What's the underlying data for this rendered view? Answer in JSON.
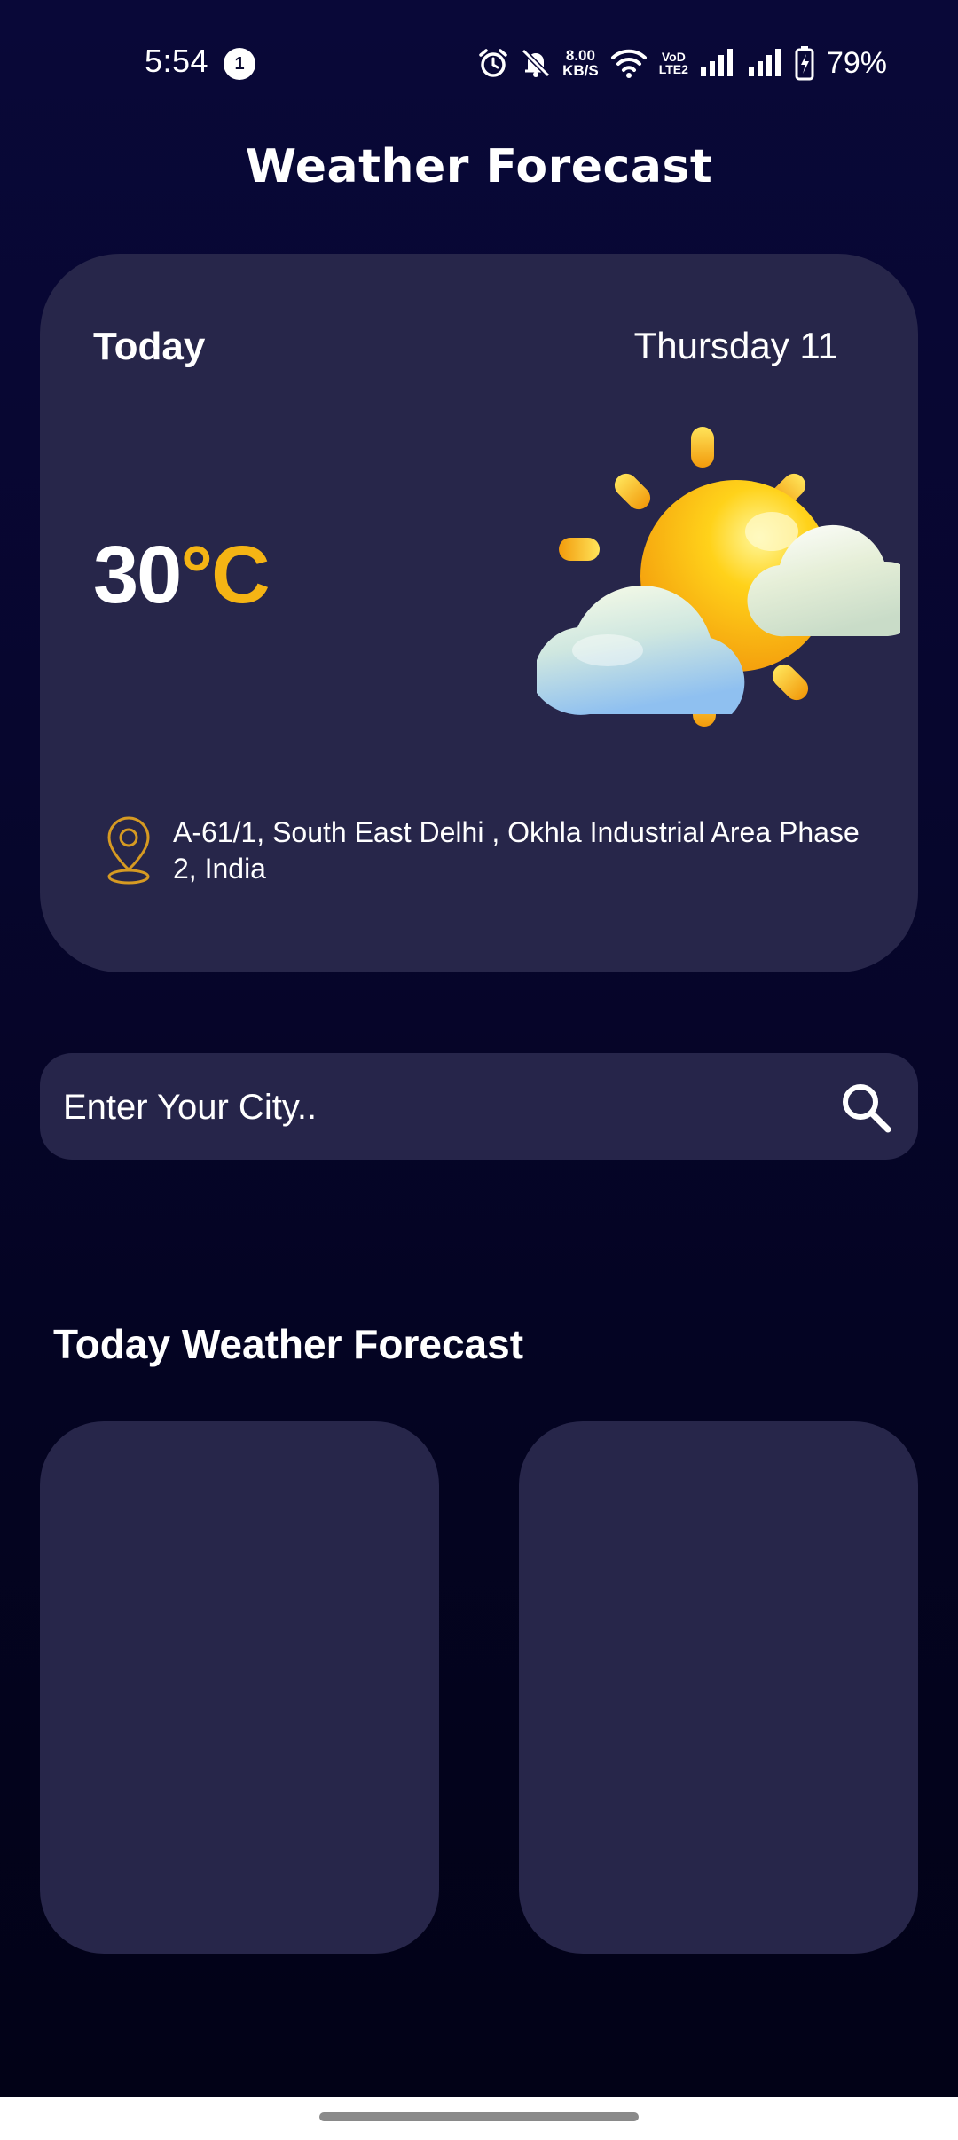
{
  "status_bar": {
    "time": "5:54",
    "notification_count": "1",
    "speed_value": "8.00",
    "speed_unit": "KB/S",
    "net_label_top": "VoD",
    "net_label_bottom": "LTE2",
    "battery": "79%",
    "icons": [
      "alarm-icon",
      "mute-bell-icon",
      "wifi-icon",
      "signal-icon",
      "signal-icon",
      "battery-charging-icon"
    ]
  },
  "app": {
    "title": "Weather Forecast"
  },
  "current": {
    "day_label": "Today",
    "date": "Thursday 11",
    "temp_value": "30",
    "temp_unit": "°C",
    "condition_icon": "partly-cloudy-sun-icon",
    "location": "A-61/1, South East Delhi , Okhla Industrial Area Phase 2, India",
    "location_icon": "location-pin-icon"
  },
  "search": {
    "placeholder": "Enter Your City..",
    "value": "",
    "icon": "search-icon"
  },
  "forecast": {
    "title": "Today Weather Forecast"
  },
  "colors": {
    "accent": "#f5b414",
    "card": "#27264a",
    "background": "#07062e"
  }
}
